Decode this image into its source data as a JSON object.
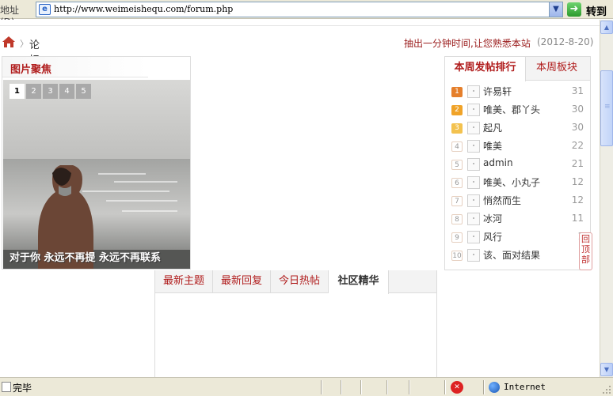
{
  "address_bar": {
    "label": "地址 (D)",
    "url": "http://www.weimeishequ.com/forum.php",
    "go_label": "转到"
  },
  "breadcrumb": {
    "current": "论坛",
    "separator": "〉"
  },
  "promo": {
    "text": "抽出一分钟时间,让您熟悉本站",
    "date": "(2012-8-20)"
  },
  "picture_focus": {
    "title": "图片聚焦",
    "numbers": [
      "1",
      "2",
      "3",
      "4",
      "5"
    ],
    "active": "1",
    "caption": "对于你 永远不再提 永远不再联系"
  },
  "ranking": {
    "tabs": [
      "本周发帖排行",
      "本周板块"
    ],
    "active_tab": "本周发帖排行",
    "items": [
      {
        "rank": "1",
        "name": "许易轩",
        "count": "31"
      },
      {
        "rank": "2",
        "name": "唯美、郡丫头",
        "count": "30"
      },
      {
        "rank": "3",
        "name": "起凡",
        "count": "30"
      },
      {
        "rank": "4",
        "name": "唯美",
        "count": "22"
      },
      {
        "rank": "5",
        "name": "admin",
        "count": "21"
      },
      {
        "rank": "6",
        "name": "唯美、小丸子",
        "count": "12"
      },
      {
        "rank": "7",
        "name": "悄然而生",
        "count": "12"
      },
      {
        "rank": "8",
        "name": "冰河",
        "count": "11"
      },
      {
        "rank": "9",
        "name": "风行",
        "count": "1"
      },
      {
        "rank": "10",
        "name": "该、面对结果",
        "count": ""
      }
    ]
  },
  "back_to_top": "回顶部",
  "news_tabs": {
    "tabs": [
      "最新主题",
      "最新回复",
      "今日热帖",
      "社区精华"
    ],
    "active": "社区精华"
  },
  "status_bar": {
    "text": "完毕",
    "zone": "Internet"
  },
  "colors": {
    "accent_red": "#b01c1c",
    "xp_chrome": "#ece9d8",
    "scroll_blue": "#c2d4f8"
  },
  "icons": [
    "page-icon",
    "dropdown-arrow-icon",
    "go-arrow-icon",
    "home-icon",
    "avatar-icon",
    "popup-blocked-icon",
    "globe-icon",
    "resize-grip-icon"
  ]
}
